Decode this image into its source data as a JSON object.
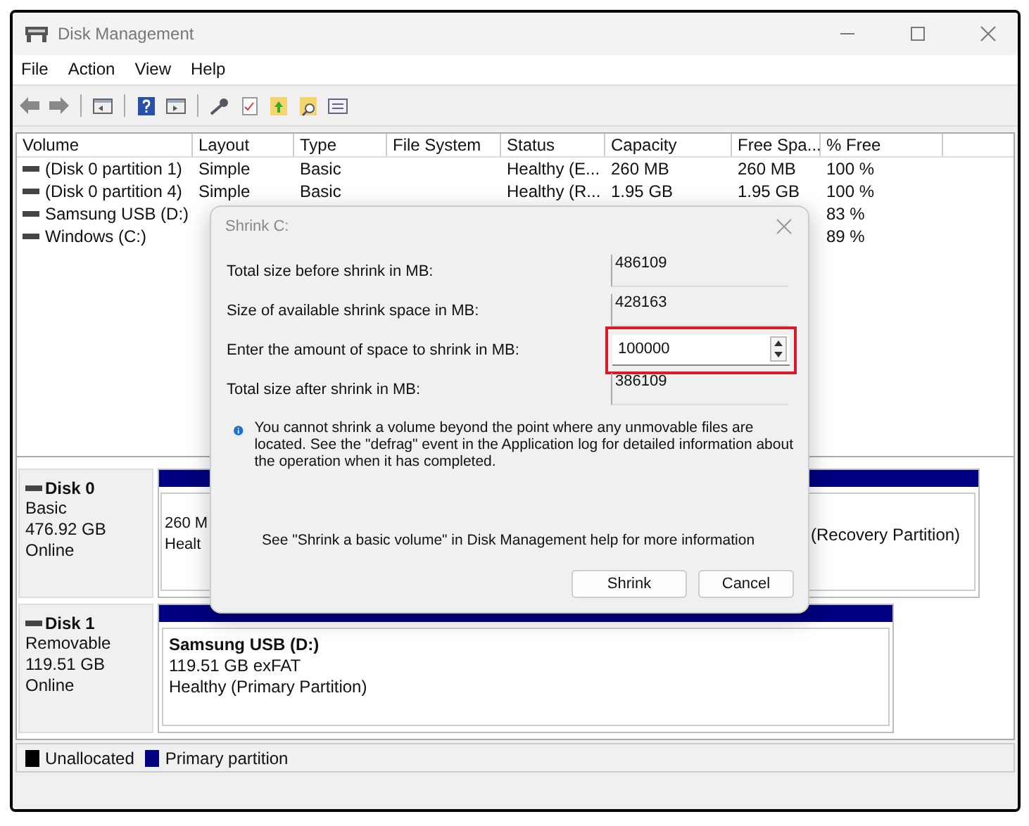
{
  "window": {
    "title": "Disk Management"
  },
  "menu": [
    "File",
    "Action",
    "View",
    "Help"
  ],
  "volume_list": {
    "columns": [
      "Volume",
      "Layout",
      "Type",
      "File System",
      "Status",
      "Capacity",
      "Free Spa...",
      "% Free"
    ],
    "rows": [
      {
        "cells": [
          "(Disk 0 partition 1)",
          "Simple",
          "Basic",
          null,
          "Healthy (E...",
          "260 MB",
          "260 MB",
          "100 %"
        ]
      },
      {
        "cells": [
          "(Disk 0 partition 4)",
          "Simple",
          "Basic",
          null,
          "Healthy (R...",
          "1.95 GB",
          "1.95 GB",
          "100 %"
        ]
      },
      {
        "cells": [
          "Samsung USB (D:)",
          null,
          null,
          null,
          null,
          null,
          null,
          "83 %"
        ]
      },
      {
        "cells": [
          "Windows (C:)",
          null,
          null,
          null,
          null,
          null,
          null,
          "89 %"
        ]
      }
    ]
  },
  "disks": [
    {
      "name": "Disk 0",
      "type": "Basic",
      "size": "476.92 GB",
      "status": "Online",
      "partitions": [
        {
          "lines": [
            "260 M",
            "Healt"
          ]
        },
        {
          "lines": [
            "(Recovery Partition)"
          ]
        }
      ]
    },
    {
      "name": "Disk 1",
      "type": "Removable",
      "size": "119.51 GB",
      "status": "Online",
      "partitions": [
        {
          "title": "Samsung USB  (D:)",
          "lines": [
            "119.51 GB exFAT",
            "Healthy (Primary Partition)"
          ]
        }
      ]
    }
  ],
  "legend": [
    {
      "label": "Unallocated",
      "color": "#000000"
    },
    {
      "label": "Primary partition",
      "color": "#000080"
    }
  ],
  "dialog": {
    "title": "Shrink C:",
    "fields": [
      {
        "kind": "readonly",
        "label": "Total size before shrink in MB:",
        "value": "486109"
      },
      {
        "kind": "readonly",
        "label": "Size of available shrink space in MB:",
        "value": "428163"
      },
      {
        "kind": "spin",
        "label": "Enter the amount of space to shrink in MB:",
        "value": "100000",
        "highlighted": true
      },
      {
        "kind": "readonly",
        "label": "Total size after shrink in MB:",
        "value": "386109"
      }
    ],
    "info": "You cannot shrink a volume beyond the point where any unmovable files are located. See the \"defrag\" event in the Application log for detailed information about the operation when it has completed.",
    "help": "See \"Shrink a basic volume\" in Disk Management help for more information",
    "buttons": [
      "Shrink",
      "Cancel"
    ]
  }
}
